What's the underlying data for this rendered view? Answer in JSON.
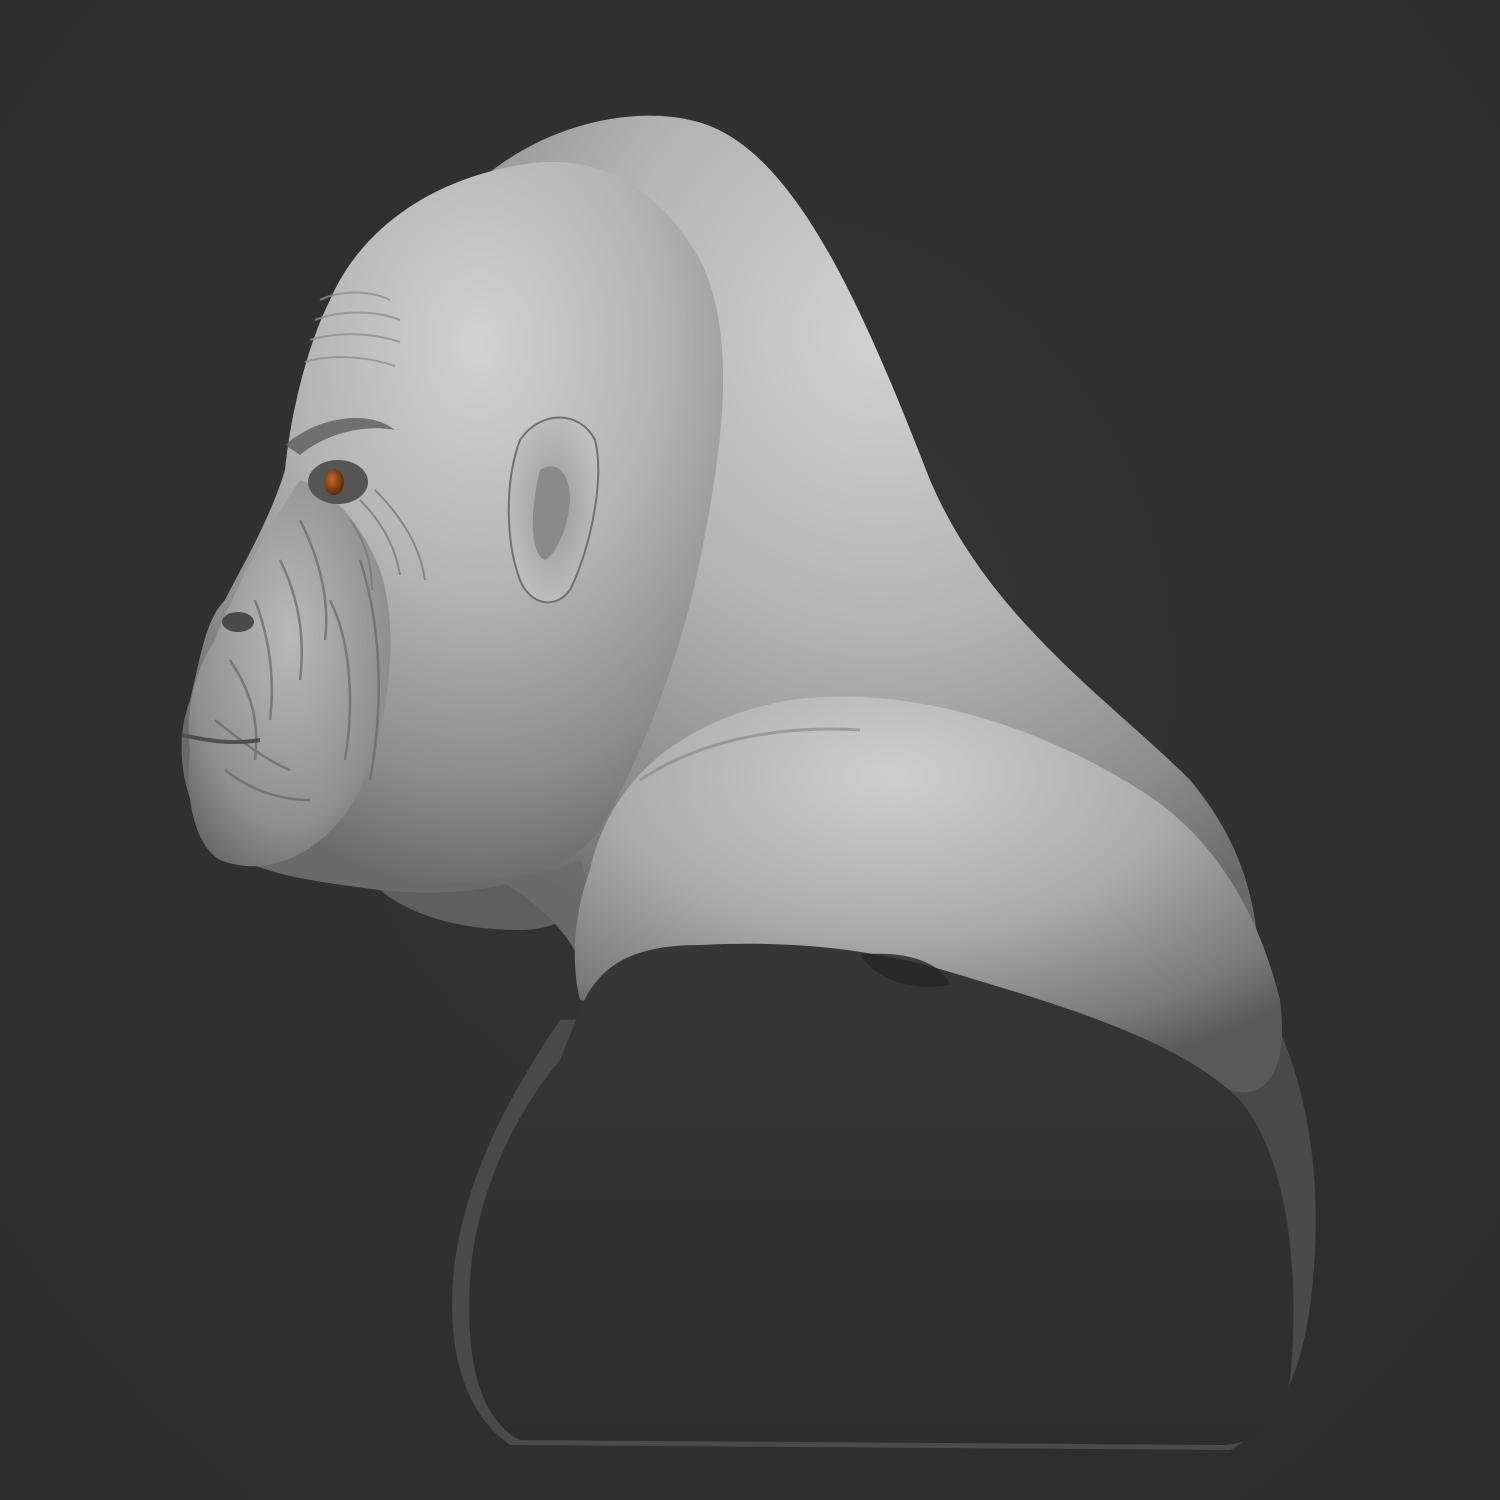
{
  "scene": {
    "subject": "gorilla-bust",
    "view": "left-profile",
    "colors": {
      "background": "#303030",
      "clay_light": "#c9c9c9",
      "clay_mid": "#9d9d9d",
      "clay_dark": "#5e5e5e",
      "cut_face": "#2f2f2f",
      "iris": "#8a4a1c"
    }
  }
}
